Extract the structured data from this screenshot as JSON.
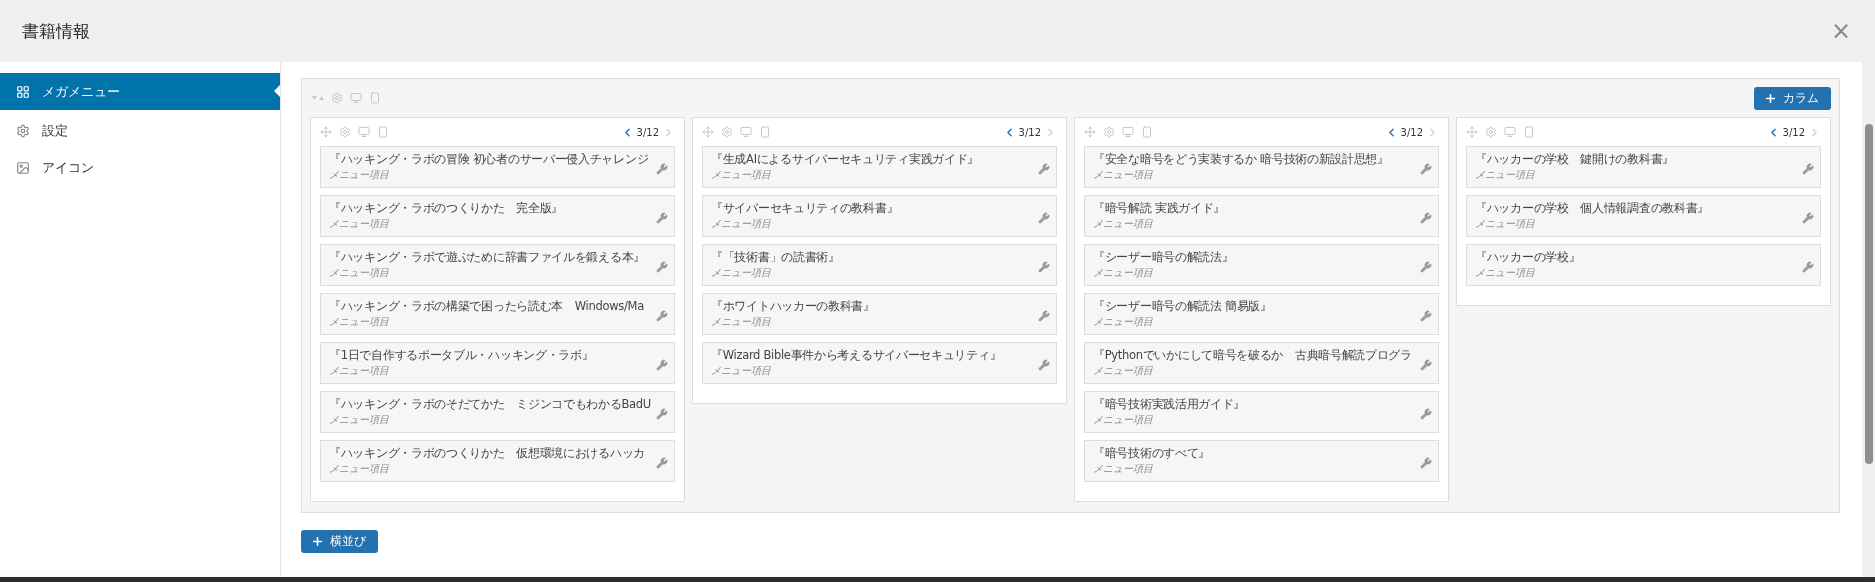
{
  "window": {
    "title": "書籍情報",
    "close": "×"
  },
  "sidebar": {
    "items": [
      {
        "label": "メガメニュー",
        "selected": true
      },
      {
        "label": "設定",
        "selected": false
      },
      {
        "label": "アイコン",
        "selected": false
      }
    ]
  },
  "mega_menu": {
    "add_column_button": "カラム",
    "add_row_button": "横並び",
    "columns": [
      {
        "width": "3/12",
        "items": [
          {
            "title": "『ハッキング・ラボの冒険 初心者のサーバー侵入チャレンジ",
            "subtitle": "メニュー項目"
          },
          {
            "title": "『ハッキング・ラボのつくりかた　完全版』",
            "subtitle": "メニュー項目"
          },
          {
            "title": "『ハッキング・ラボで遊ぶために辞書ファイルを鍛える本』",
            "subtitle": "メニュー項目"
          },
          {
            "title": "『ハッキング・ラボの構築で困ったら読む本　Windows/Ma",
            "subtitle": "メニュー項目"
          },
          {
            "title": "『1日で自作するポータブル・ハッキング・ラボ』",
            "subtitle": "メニュー項目"
          },
          {
            "title": "『ハッキング・ラボのそだてかた　ミジンコでもわかるBadU",
            "subtitle": "メニュー項目"
          },
          {
            "title": "『ハッキング・ラボのつくりかた　仮想環境におけるハッカ",
            "subtitle": "メニュー項目"
          }
        ]
      },
      {
        "width": "3/12",
        "items": [
          {
            "title": "『生成AIによるサイバーセキュリティ実践ガイド』",
            "subtitle": "メニュー項目"
          },
          {
            "title": "『サイバーセキュリティの教科書』",
            "subtitle": "メニュー項目"
          },
          {
            "title": "『「技術書」の読書術』",
            "subtitle": "メニュー項目"
          },
          {
            "title": "『ホワイトハッカーの教科書』",
            "subtitle": "メニュー項目"
          },
          {
            "title": "『Wizard Bible事件から考えるサイバーセキュリティ』",
            "subtitle": "メニュー項目"
          }
        ]
      },
      {
        "width": "3/12",
        "items": [
          {
            "title": "『安全な暗号をどう実装するか 暗号技術の新設計思想』",
            "subtitle": "メニュー項目"
          },
          {
            "title": "『暗号解読 実践ガイド』",
            "subtitle": "メニュー項目"
          },
          {
            "title": "『シーザー暗号の解読法』",
            "subtitle": "メニュー項目"
          },
          {
            "title": "『シーザー暗号の解読法 簡易版』",
            "subtitle": "メニュー項目"
          },
          {
            "title": "『Pythonでいかにして暗号を破るか　古典暗号解読プログラ",
            "subtitle": "メニュー項目"
          },
          {
            "title": "『暗号技術実践活用ガイド』",
            "subtitle": "メニュー項目"
          },
          {
            "title": "『暗号技術のすべて』",
            "subtitle": "メニュー項目"
          }
        ]
      },
      {
        "width": "3/12",
        "items": [
          {
            "title": "『ハッカーの学校　鍵開けの教科書』",
            "subtitle": "メニュー項目"
          },
          {
            "title": "『ハッカーの学校　個人情報調査の教科書』",
            "subtitle": "メニュー項目"
          },
          {
            "title": "『ハッカーの学校』",
            "subtitle": "メニュー項目"
          }
        ]
      }
    ]
  }
}
